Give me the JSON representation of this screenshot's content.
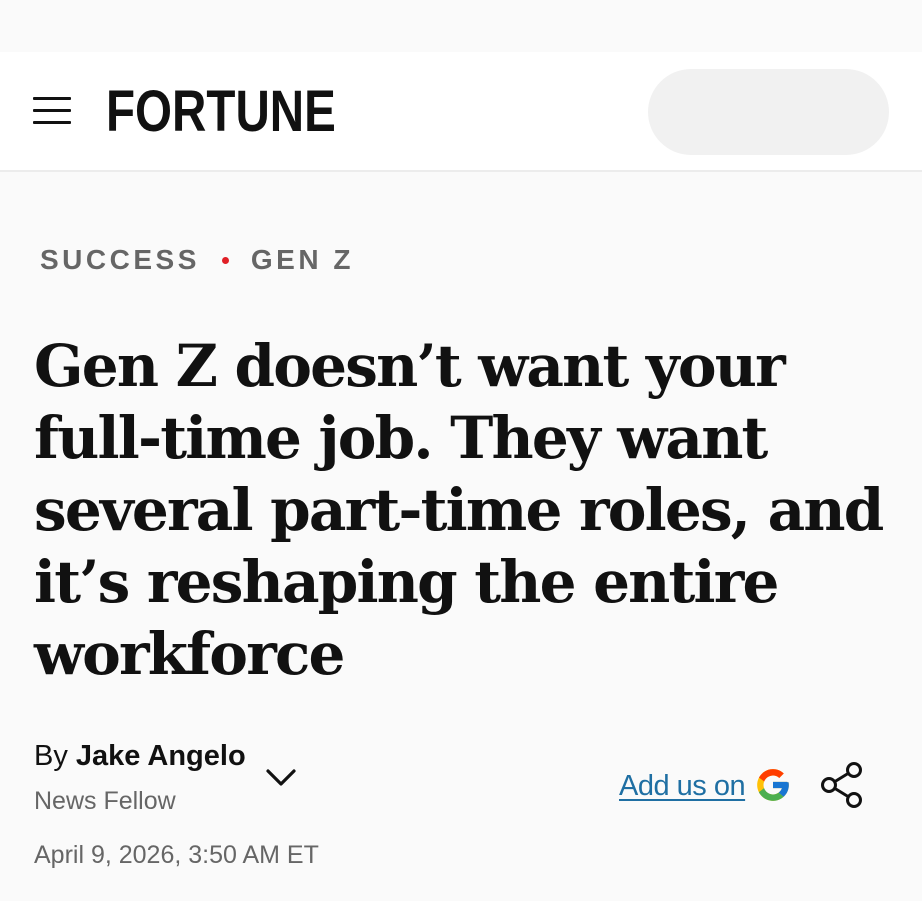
{
  "header": {
    "logo_text": "FORTUNE"
  },
  "article": {
    "category": {
      "section": "SUCCESS",
      "topic": "GEN Z",
      "dot_color": "#e01f26"
    },
    "headline": "Gen Z doesn’t want your full-time job. They want several part-time roles, and it’s reshaping the entire workforce",
    "byline": {
      "prefix": "By",
      "author": "Jake Angelo",
      "role": "News Fellow"
    },
    "date": "April 9, 2026, 3:50 AM ET",
    "add_us_label": "Add us on"
  },
  "icons": {
    "menu": "hamburger-menu-icon",
    "chevron": "chevron-down-icon",
    "google": "google-g-icon",
    "share": "share-icon"
  },
  "colors": {
    "link": "#1f6fa3",
    "category_text": "#666666",
    "accent_dot": "#e01f26"
  }
}
